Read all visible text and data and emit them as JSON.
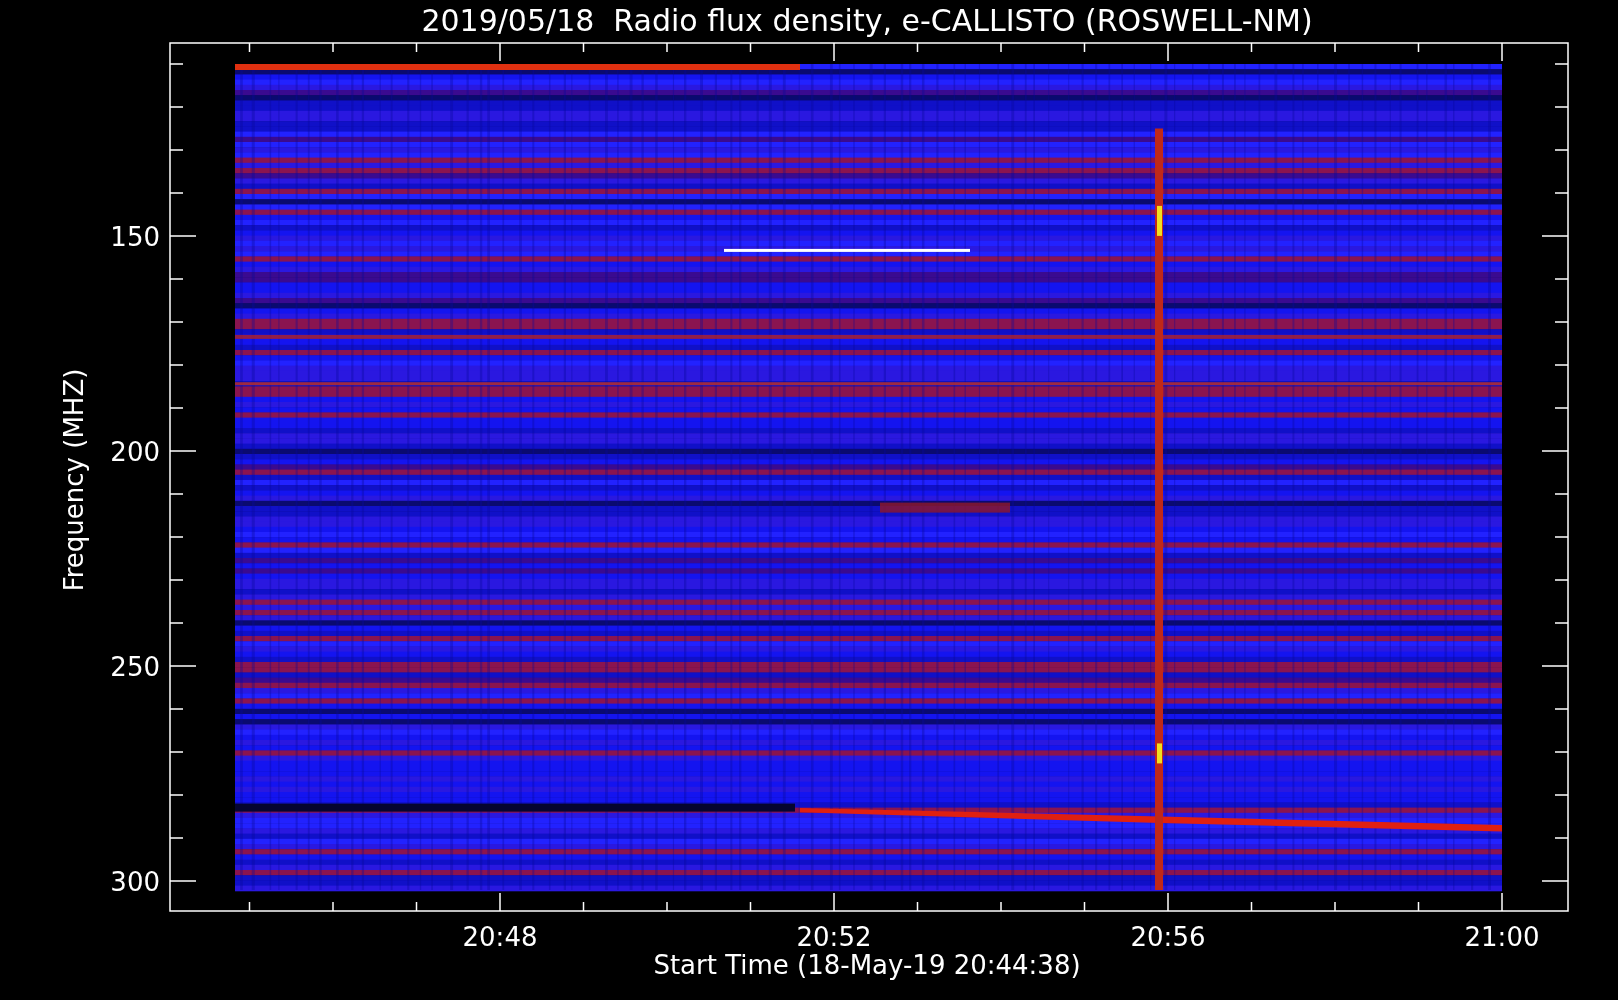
{
  "plot": {
    "title": "2019/05/18  Radio flux density, e-CALLISTO (ROSWELL-NM)",
    "xlabel": "Start Time (18-May-19 20:44:38)",
    "ylabel": "Frequency (MHZ)",
    "xticks": [
      "20:48",
      "20:52",
      "20:56",
      "21:00"
    ],
    "yticks": [
      "150",
      "200",
      "250",
      "300"
    ]
  }
}
